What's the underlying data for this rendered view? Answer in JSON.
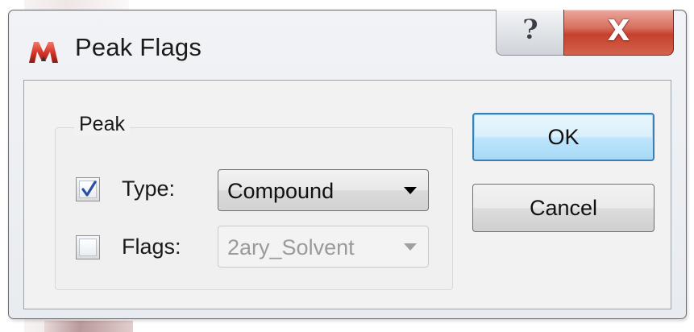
{
  "window": {
    "title": "Peak Flags",
    "help_glyph": "?",
    "close_glyph": "X"
  },
  "group": {
    "label": "Peak"
  },
  "rows": {
    "type": {
      "label": "Type:",
      "checked": true,
      "value": "Compound",
      "enabled": true
    },
    "flags": {
      "label": "Flags:",
      "checked": false,
      "value": "2ary_Solvent",
      "enabled": false
    }
  },
  "buttons": {
    "ok": "OK",
    "cancel": "Cancel"
  },
  "icons": {
    "app": "app-logo-icon",
    "help": "help-icon",
    "close": "close-icon",
    "check": "checkmark-icon",
    "dropdown": "chevron-down-icon"
  },
  "colors": {
    "close_button": "#c4412c",
    "default_button_border": "#3c7fb1",
    "checkmark": "#2b4fa8",
    "app_icon": "#d8362a"
  }
}
